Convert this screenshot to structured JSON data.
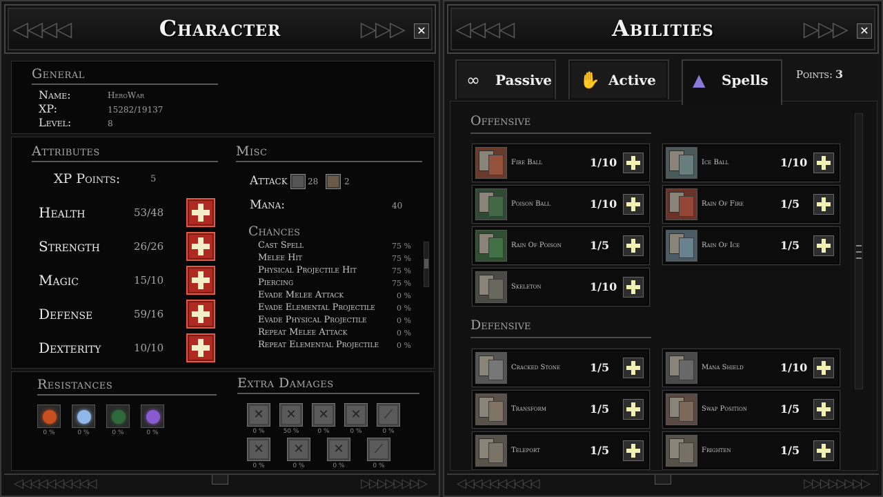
{
  "character": {
    "title": "Character",
    "general": {
      "title": "General",
      "name_label": "Name:",
      "name_value": "HeroWar",
      "xp_label": "XP:",
      "xp_value": "15282/19137",
      "level_label": "Level:",
      "level_value": "8"
    },
    "attributes": {
      "title": "Attributes",
      "xp_points_label": "XP Points:",
      "xp_points_value": "5",
      "items": [
        {
          "name": "Health",
          "value": "53/48"
        },
        {
          "name": "Strength",
          "value": "26/26"
        },
        {
          "name": "Magic",
          "value": "15/10"
        },
        {
          "name": "Defense",
          "value": "59/16"
        },
        {
          "name": "Dexterity",
          "value": "10/10"
        }
      ]
    },
    "misc": {
      "title": "Misc",
      "attack_label": "Attack",
      "attack_value_1": "28",
      "attack_value_2": "2",
      "mana_label": "Mana:",
      "mana_value": "40",
      "chances_title": "Chances",
      "chances": [
        {
          "name": "Cast Spell",
          "value": "75 %"
        },
        {
          "name": "Melee Hit",
          "value": "75 %"
        },
        {
          "name": "Physical Projectile Hit",
          "value": "75 %"
        },
        {
          "name": "Piercing",
          "value": "75 %"
        },
        {
          "name": "Evade Melee Attack",
          "value": "0 %"
        },
        {
          "name": "Evade Elemental Projectile",
          "value": "0 %"
        },
        {
          "name": "Evade Physical Projectile",
          "value": "0 %"
        },
        {
          "name": "Repeat Melee Attack",
          "value": "0 %"
        },
        {
          "name": "Repeat Elemental Projectile",
          "value": "0 %"
        }
      ]
    },
    "resistances": {
      "title": "Resistances",
      "items": [
        {
          "icon": "fire-resistance-icon",
          "value": "0 %",
          "color": "#c8501e"
        },
        {
          "icon": "ice-resistance-icon",
          "value": "0 %",
          "color": "#8fb7e8"
        },
        {
          "icon": "poison-resistance-icon",
          "value": "0 %",
          "color": "#2f6b3a"
        },
        {
          "icon": "lightning-resistance-icon",
          "value": "0 %",
          "color": "#8a5ad0"
        }
      ]
    },
    "extra_damages": {
      "title": "Extra Damages",
      "row1": [
        {
          "icon": "crossed-swords-icon",
          "value": "0 %"
        },
        {
          "icon": "crossed-axes-icon",
          "value": "50 %"
        },
        {
          "icon": "crossed-maces-icon",
          "value": "0 %"
        },
        {
          "icon": "crossed-daggers-icon",
          "value": "0 %"
        },
        {
          "icon": "bow-icon",
          "value": "0 %"
        }
      ],
      "row2": [
        {
          "icon": "crossed-spears-icon",
          "value": "0 %"
        },
        {
          "icon": "crossed-staves-icon",
          "value": "0 %"
        },
        {
          "icon": "crossed-hammers-icon",
          "value": "0 %"
        },
        {
          "icon": "pickaxe-icon",
          "value": "0 %"
        }
      ]
    }
  },
  "abilities": {
    "title": "Abilities",
    "tabs": [
      {
        "label": "Passive",
        "icon": "∞"
      },
      {
        "label": "Active",
        "icon": "✋"
      },
      {
        "label": "Spells",
        "icon": "▲"
      }
    ],
    "points_label": "Points:",
    "points_value": "3",
    "offensive_title": "Offensive",
    "defensive_title": "Defensive",
    "offensive": [
      {
        "name": "Fire Ball",
        "level": "1/10",
        "tint": "#6a3a2a"
      },
      {
        "name": "Ice Ball",
        "level": "1/10",
        "tint": "#4a5a5a"
      },
      {
        "name": "Poison Ball",
        "level": "1/10",
        "tint": "#2f4a32"
      },
      {
        "name": "Rain Of Fire",
        "level": "1/5",
        "tint": "#6a3328"
      },
      {
        "name": "Rain Of Poison",
        "level": "1/5",
        "tint": "#2e5030"
      },
      {
        "name": "Rain Of Ice",
        "level": "1/5",
        "tint": "#4c5c66"
      },
      {
        "name": "Skeleton",
        "level": "1/10",
        "tint": "#4a4a44"
      }
    ],
    "defensive": [
      {
        "name": "Cracked Stone",
        "level": "1/5",
        "tint": "#555"
      },
      {
        "name": "Mana Shield",
        "level": "1/10",
        "tint": "#4a4a4a"
      },
      {
        "name": "Transform",
        "level": "1/5",
        "tint": "#5a5248"
      },
      {
        "name": "Swap Position",
        "level": "1/5",
        "tint": "#5a4a42"
      },
      {
        "name": "Teleport",
        "level": "1/5",
        "tint": "#58524a"
      },
      {
        "name": "Frighten",
        "level": "1/5",
        "tint": "#555048"
      }
    ]
  }
}
